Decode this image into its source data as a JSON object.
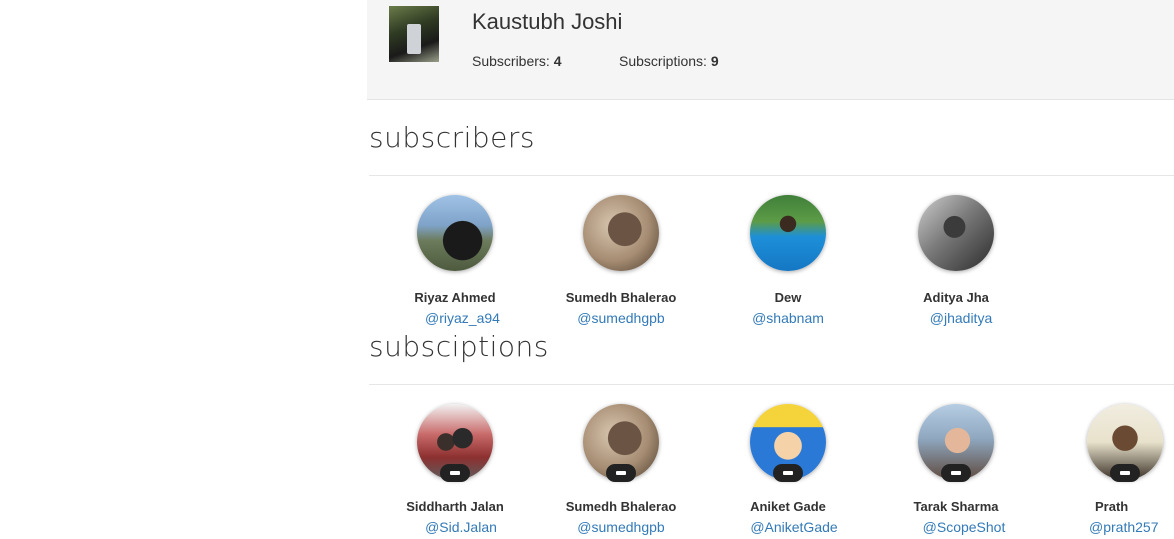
{
  "profile": {
    "name": "Kaustubh Joshi",
    "subscribers_label": "Subscribers:",
    "subscribers_count": "4",
    "subscriptions_label": "Subscriptions:",
    "subscriptions_count": "9"
  },
  "subscribers": {
    "title": "subscribers",
    "users": [
      {
        "name": "Riyaz Ahmed",
        "handle": "@riyaz_a94"
      },
      {
        "name": "Sumedh Bhalerao",
        "handle": "@sumedhgpb"
      },
      {
        "name": "Dew",
        "handle": "@shabnam"
      },
      {
        "name": "Aditya Jha",
        "handle": "@jhaditya"
      }
    ]
  },
  "subscriptions": {
    "title": "subsciptions",
    "users": [
      {
        "name": "Siddharth Jalan",
        "handle": "@Sid.Jalan"
      },
      {
        "name": "Sumedh Bhalerao",
        "handle": "@sumedhgpb"
      },
      {
        "name": "Aniket Gade",
        "handle": "@AniketGade"
      },
      {
        "name": "Tarak Sharma",
        "handle": "@ScopeShot"
      },
      {
        "name": "Prath",
        "handle": "@prath257"
      }
    ]
  },
  "colors": {
    "header_bg": "#f5f5f5",
    "link": "#337ab7",
    "badge": "#222222"
  }
}
